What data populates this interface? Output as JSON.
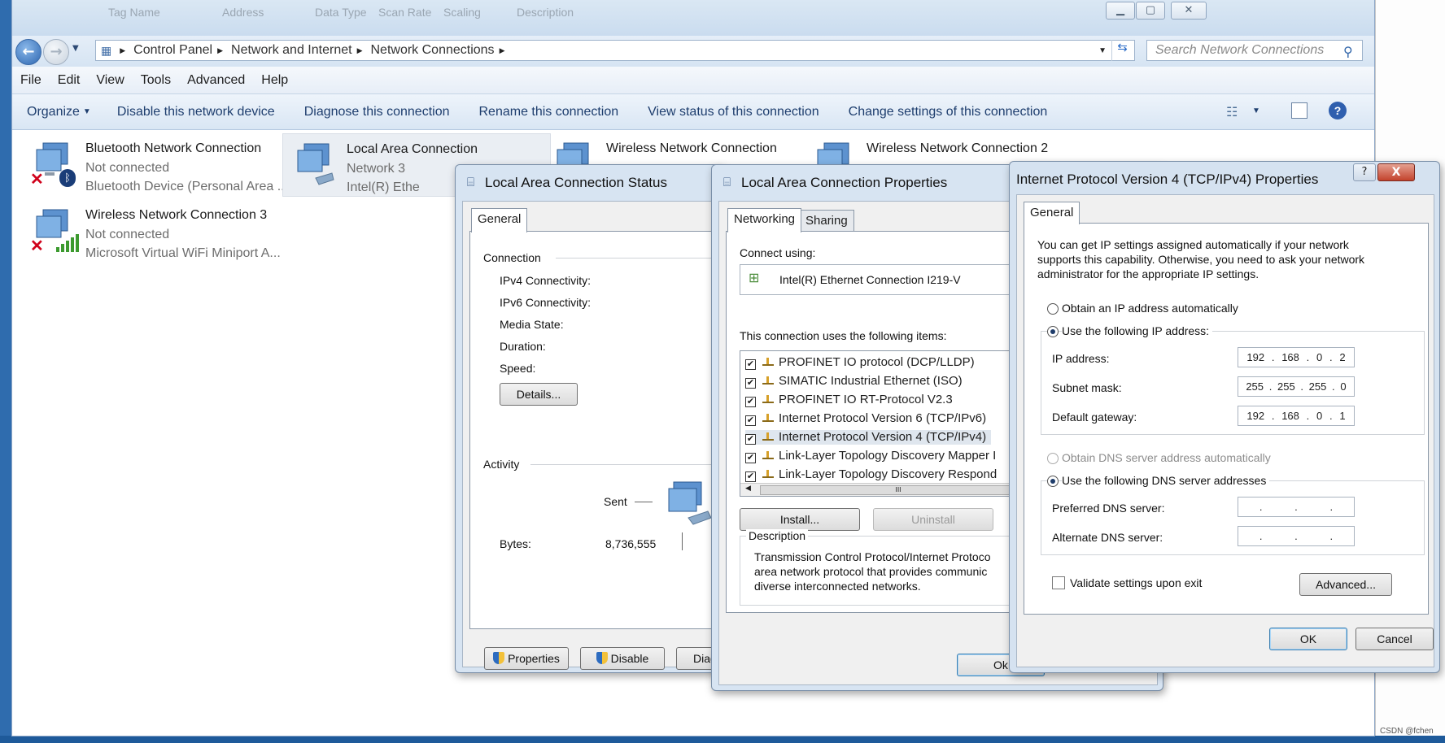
{
  "background": {
    "ghost_texts": [
      "Tag Name",
      "Address",
      "Data Type",
      "Scan Rate",
      "Scaling",
      "Description"
    ]
  },
  "explorer": {
    "breadcrumb": [
      "Control Panel",
      "Network and Internet",
      "Network Connections"
    ],
    "search_placeholder": "Search Network Connections",
    "menu": [
      "File",
      "Edit",
      "View",
      "Tools",
      "Advanced",
      "Help"
    ],
    "commands": [
      "Organize",
      "Disable this network device",
      "Diagnose this connection",
      "Rename this connection",
      "View status of this connection",
      "Change settings of this connection"
    ],
    "connections": [
      {
        "name": "Bluetooth Network Connection",
        "status": "Not connected",
        "device": "Bluetooth Device (Personal Area ..."
      },
      {
        "name": "Local Area Connection",
        "status": "Network  3",
        "device": "Intel(R) Ethe"
      },
      {
        "name": "Wireless Network Connection",
        "status": "",
        "device": ""
      },
      {
        "name": "Wireless Network Connection 2",
        "status": "",
        "device": ""
      },
      {
        "name": "Wireless Network Connection 3",
        "status": "Not connected",
        "device": "Microsoft Virtual WiFi Miniport A..."
      }
    ]
  },
  "status_dialog": {
    "title": "Local Area Connection Status",
    "tab": "General",
    "connection_group": "Connection",
    "fields": [
      "IPv4 Connectivity:",
      "IPv6 Connectivity:",
      "Media State:",
      "Duration:",
      "Speed:"
    ],
    "details_button": "Details...",
    "activity_group": "Activity",
    "sent_label": "Sent",
    "bytes_label": "Bytes:",
    "bytes_sent": "8,736,555",
    "buttons": [
      "Properties",
      "Disable",
      "Diag"
    ]
  },
  "props_dialog": {
    "title": "Local Area Connection Properties",
    "tabs": [
      "Networking",
      "Sharing"
    ],
    "connect_using_label": "Connect using:",
    "adapter": "Intel(R) Ethernet Connection I219-V",
    "items_label": "This connection uses the following items:",
    "items": [
      "PROFINET IO protocol (DCP/LLDP)",
      "SIMATIC Industrial Ethernet (ISO)",
      "PROFINET IO RT-Protocol V2.3",
      "Internet Protocol Version 6 (TCP/IPv6)",
      "Internet Protocol Version 4 (TCP/IPv4)",
      "Link-Layer Topology Discovery Mapper I",
      "Link-Layer Topology Discovery Respond"
    ],
    "scroll_thumb": "III",
    "install_button": "Install...",
    "uninstall_button": "Uninstall",
    "description_group": "Description",
    "description_lines": [
      "Transmission Control Protocol/Internet Protoco",
      "area network protocol that provides communic",
      "diverse interconnected networks."
    ],
    "ok_button": "Ok"
  },
  "ipv4_dialog": {
    "title": "Internet Protocol Version 4 (TCP/IPv4) Properties",
    "help_glyph": "?",
    "close_glyph": "X",
    "tab": "General",
    "intro_lines": [
      "You can get IP settings assigned automatically if your network",
      "supports this capability. Otherwise, you need to ask your network",
      "administrator for the appropriate IP settings."
    ],
    "obtain_ip_auto": "Obtain an IP address automatically",
    "use_following_ip": "Use the following IP address:",
    "ip_label": "IP address:",
    "ip": [
      "192",
      "168",
      "0",
      "2"
    ],
    "mask_label": "Subnet mask:",
    "mask": [
      "255",
      "255",
      "255",
      "0"
    ],
    "gateway_label": "Default gateway:",
    "gateway": [
      "192",
      "168",
      "0",
      "1"
    ],
    "obtain_dns_auto": "Obtain DNS server address automatically",
    "use_following_dns": "Use the following DNS server addresses",
    "preferred_dns_label": "Preferred DNS server:",
    "alternate_dns_label": "Alternate DNS server:",
    "validate_label": "Validate settings upon exit",
    "advanced_button": "Advanced...",
    "ok_button": "OK",
    "cancel_button": "Cancel"
  },
  "watermark": "CSDN @fchen"
}
